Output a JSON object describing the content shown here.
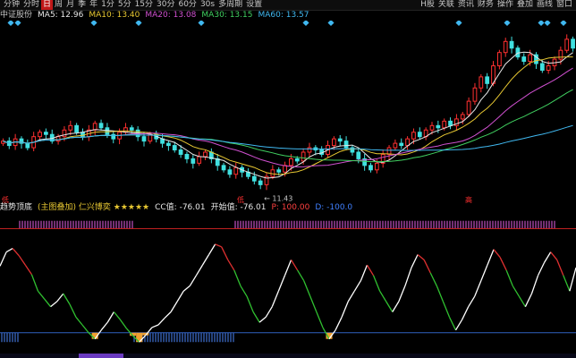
{
  "toolbar": {
    "items": [
      "分钟",
      "分时",
      "日",
      "周",
      "月",
      "季",
      "年",
      "1分",
      "5分",
      "15分",
      "30分",
      "60分",
      "30s",
      "多周期",
      "设置"
    ],
    "selected": "日",
    "right_items": [
      "H股",
      "关联",
      "资讯",
      "财务",
      "操作",
      "叠加",
      "画线",
      "窗口"
    ]
  },
  "ma_legend": [
    {
      "label": "中证股份",
      "color": "#c8c8c8"
    },
    {
      "label": "MA5: 12.96",
      "color": "#e8e8e8"
    },
    {
      "label": "MA10: 13.40",
      "color": "#e8c832"
    },
    {
      "label": "MA20: 13.08",
      "color": "#d050d0"
    },
    {
      "label": "MA30: 13.15",
      "color": "#40d060"
    },
    {
      "label": "MA60: 13.57",
      "color": "#40b8f0"
    }
  ],
  "ind_legend": [
    {
      "label": "趋势顶底",
      "color": "#e8e8e8"
    },
    {
      "label": "(主图叠加) 仁兴博奕 ★★★★★",
      "color": "#e8c832"
    },
    {
      "label": "CC值: -76.01",
      "color": "#e8e8e8"
    },
    {
      "label": "开始值: -76.01",
      "color": "#e8e8e8"
    },
    {
      "label": "P: 100.00",
      "color": "#ff4040"
    },
    {
      "label": "D: -100.0",
      "color": "#4080ff"
    }
  ],
  "annotations": {
    "low_price": "11.43",
    "flag_left": "低",
    "flag_mid": "低",
    "flag_right": "高"
  },
  "colors": {
    "up": "#ff3030",
    "down": "#40e0e0",
    "ma5": "#e8e8e8",
    "ma10": "#e8c832",
    "ma20": "#d050d0",
    "ma30": "#40d060",
    "ma60": "#40b8f0",
    "upper_band": "#d050d0",
    "lower_band": "#4080ff"
  },
  "chart_data": {
    "type": "candlestick",
    "closes": [
      13.4,
      13.2,
      13.5,
      13.3,
      13.1,
      13.6,
      13.8,
      13.7,
      13.4,
      13.6,
      13.9,
      14.1,
      13.8,
      13.6,
      13.9,
      14.2,
      14.0,
      13.7,
      13.5,
      13.8,
      14.0,
      13.9,
      13.6,
      13.4,
      13.7,
      13.5,
      13.3,
      13.2,
      13.0,
      12.8,
      12.6,
      12.4,
      12.7,
      12.9,
      12.6,
      12.3,
      12.1,
      11.9,
      12.2,
      12.0,
      11.8,
      11.6,
      11.43,
      11.8,
      12.1,
      12.0,
      12.3,
      12.6,
      12.5,
      12.9,
      13.1,
      13.0,
      12.8,
      13.2,
      13.5,
      13.4,
      13.1,
      12.9,
      12.6,
      12.3,
      12.1,
      12.4,
      12.8,
      13.1,
      13.3,
      13.2,
      13.5,
      13.8,
      13.6,
      13.9,
      14.1,
      14.0,
      14.3,
      14.1,
      14.4,
      14.6,
      15.2,
      15.8,
      16.3,
      16.0,
      16.8,
      17.4,
      17.9,
      17.6,
      17.2,
      17.0,
      17.3,
      16.9,
      16.6,
      16.8,
      17.1,
      17.5,
      18.0,
      17.6
    ],
    "indicator": [
      28,
      55,
      62,
      48,
      30,
      12,
      -20,
      -35,
      -50,
      -40,
      -25,
      -45,
      -70,
      -85,
      -100,
      -112,
      -95,
      -80,
      -60,
      -75,
      -92,
      -106,
      -118,
      -105,
      -90,
      -85,
      -72,
      -60,
      -40,
      -20,
      -10,
      10,
      30,
      50,
      70,
      65,
      40,
      20,
      -10,
      -30,
      -60,
      -80,
      -70,
      -50,
      -20,
      10,
      40,
      20,
      0,
      -30,
      -60,
      -90,
      -112,
      -95,
      -70,
      -40,
      -20,
      0,
      30,
      10,
      -20,
      -40,
      -60,
      -40,
      -10,
      25,
      50,
      40,
      15,
      -10,
      -40,
      -70,
      -95,
      -75,
      -50,
      -30,
      0,
      30,
      60,
      45,
      20,
      -10,
      -30,
      -50,
      -25,
      10,
      35,
      55,
      40,
      10,
      -20,
      25
    ],
    "upper_band": 100,
    "lower_band": -100,
    "ylim": [
      11.0,
      18.6
    ],
    "indicator_ylim": [
      -140,
      130
    ]
  }
}
